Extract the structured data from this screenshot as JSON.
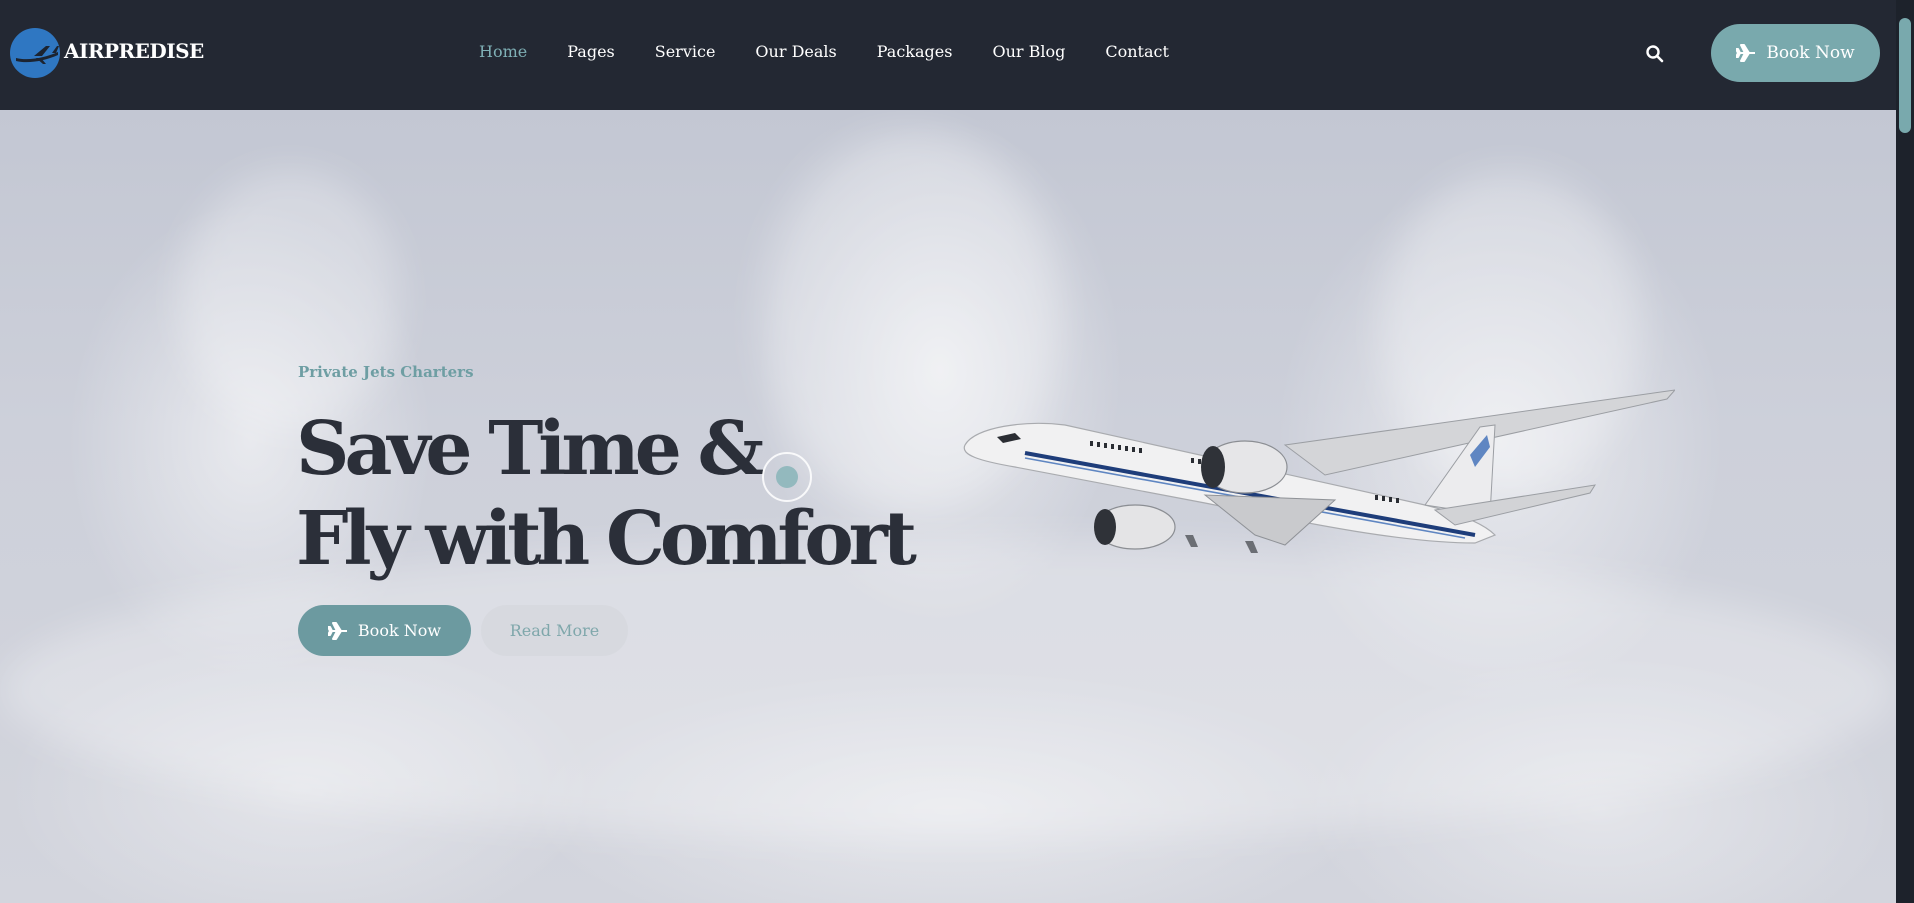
{
  "header": {
    "logo_text": "AIRPREDISE",
    "nav": [
      {
        "label": "Home",
        "active": true
      },
      {
        "label": "Pages",
        "active": false
      },
      {
        "label": "Service",
        "active": false
      },
      {
        "label": "Our Deals",
        "active": false
      },
      {
        "label": "Packages",
        "active": false
      },
      {
        "label": "Our Blog",
        "active": false
      },
      {
        "label": "Contact",
        "active": false
      }
    ],
    "search_icon": "search-icon",
    "book_label": "Book Now"
  },
  "hero": {
    "eyebrow": "Private Jets Charters",
    "headline_line1": "Save Time &",
    "headline_line2": "Fly with Comfort",
    "book_label": "Book Now",
    "read_more_label": "Read More"
  },
  "colors": {
    "header_bg": "#232833",
    "accent": "#79a9ad",
    "nav_active": "#7fb0b6",
    "headline": "#2b2f39"
  }
}
